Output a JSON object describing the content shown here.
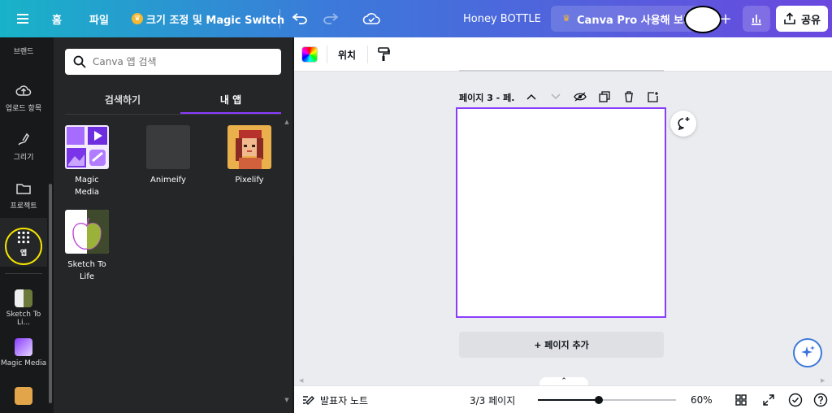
{
  "topbar": {
    "home_label": "홈",
    "file_label": "파일",
    "resize_label": "크기 조정 및 Magic Switch",
    "doc_title": "Honey BOTTLE",
    "pro_label": "Canva Pro 사용해 보기",
    "share_label": "공유",
    "crown_glyph": "♛",
    "plus_glyph": "+"
  },
  "rail": {
    "items": [
      {
        "label": "브랜드",
        "icon": "brand-icon"
      },
      {
        "label": "업로드 항목",
        "icon": "upload-cloud-icon"
      },
      {
        "label": "그리기",
        "icon": "draw-icon"
      },
      {
        "label": "프로젝트",
        "icon": "folder-icon"
      },
      {
        "label": "앱",
        "icon": "apps-grid-icon",
        "active": true
      },
      {
        "label": "Sketch To Li...",
        "icon": "sketch-to-life-app-icon"
      },
      {
        "label": "Magic Media",
        "icon": "magic-media-app-icon"
      },
      {
        "label": "",
        "icon": "pixelify-app-icon"
      }
    ]
  },
  "panel": {
    "search_placeholder": "Canva 앱 검색",
    "tabs": [
      {
        "label": "검색하기",
        "active": false
      },
      {
        "label": "내 앱",
        "active": true
      }
    ],
    "apps": [
      {
        "name": "Magic Media",
        "icon": "magic-media-thumb"
      },
      {
        "name": "Animeify",
        "icon": "animeify-thumb"
      },
      {
        "name": "Pixelify",
        "icon": "pixelify-thumb"
      },
      {
        "name": "Sketch To Life",
        "icon": "sketch-to-life-thumb"
      }
    ]
  },
  "editor": {
    "position_label": "위치",
    "page_label": "페이지 3 - 페.",
    "add_page_label": "+ 페이지 추가"
  },
  "footer": {
    "notes_label": "발표자 노트",
    "page_count": "3/3 페이지",
    "zoom_level": 0.44,
    "zoom_pct": "60%"
  },
  "colors": {
    "accent": "#8b3dff",
    "highlight": "#f5e400"
  }
}
